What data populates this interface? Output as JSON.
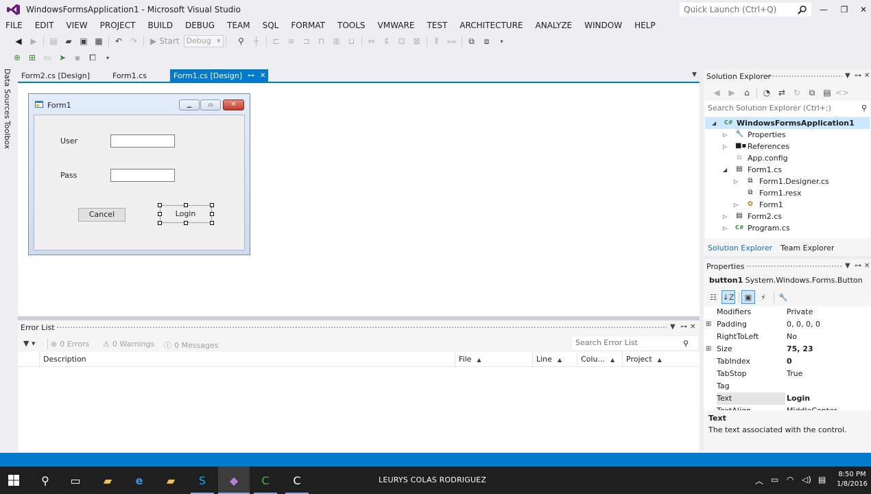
{
  "window": {
    "title": "WindowsFormsApplication1 - Microsoft Visual Studio",
    "quick_launch_placeholder": "Quick Launch (Ctrl+Q)"
  },
  "menu": [
    "FILE",
    "EDIT",
    "VIEW",
    "PROJECT",
    "BUILD",
    "DEBUG",
    "TEAM",
    "SQL",
    "FORMAT",
    "TOOLS",
    "VMWARE",
    "TEST",
    "ARCHITECTURE",
    "ANALYZE",
    "WINDOW",
    "HELP"
  ],
  "toolbar": {
    "start_label": "Start",
    "config_value": "Debug"
  },
  "side_tabs": {
    "data_sources": "Data Sources",
    "toolbox": "Toolbox"
  },
  "doc_tabs": [
    {
      "label": "Form2.cs [Design]",
      "active": false
    },
    {
      "label": "Form1.cs",
      "active": false
    },
    {
      "label": "Form1.cs [Design]",
      "active": true
    }
  ],
  "form1": {
    "title": "Form1",
    "user_label": "User",
    "pass_label": "Pass",
    "cancel_button": "Cancel",
    "login_button": "Login"
  },
  "error_list": {
    "title": "Error List",
    "errors": "0 Errors",
    "warnings": "0 Warnings",
    "messages": "0 Messages",
    "search_placeholder": "Search Error List",
    "columns": [
      "Description",
      "File",
      "Line",
      "Colu...",
      "Project"
    ]
  },
  "solution_explorer": {
    "title": "Solution Explorer",
    "search_placeholder": "Search Solution Explorer (Ctrl+;)",
    "items": [
      {
        "label": "WindowsFormsApplication1",
        "icon": "csharp-project-icon",
        "expander": "expanded",
        "selected": true
      },
      {
        "label": "Properties",
        "icon": "wrench-icon",
        "expander": "collapsed"
      },
      {
        "label": "References",
        "icon": "references-icon",
        "expander": "collapsed"
      },
      {
        "label": "App.config",
        "icon": "config-file-icon",
        "expander": "none"
      },
      {
        "label": "Form1.cs",
        "icon": "form-file-icon",
        "expander": "expanded"
      },
      {
        "label": "Form1.Designer.cs",
        "icon": "designer-file-icon",
        "expander": "collapsed"
      },
      {
        "label": "Form1.resx",
        "icon": "resx-file-icon",
        "expander": "none"
      },
      {
        "label": "Form1",
        "icon": "class-icon",
        "expander": "collapsed"
      },
      {
        "label": "Form2.cs",
        "icon": "form-file-icon",
        "expander": "collapsed"
      },
      {
        "label": "Program.cs",
        "icon": "csharp-file-icon",
        "expander": "collapsed"
      }
    ],
    "tabs": [
      "Solution Explorer",
      "Team Explorer"
    ]
  },
  "properties": {
    "title": "Properties",
    "object_name": "button1",
    "object_type": "System.Windows.Forms.Button",
    "rows": [
      {
        "name": "Modifiers",
        "value": "Private",
        "expandable": false,
        "bold": false
      },
      {
        "name": "Padding",
        "value": "0, 0, 0, 0",
        "expandable": true,
        "bold": false
      },
      {
        "name": "RightToLeft",
        "value": "No",
        "expandable": false,
        "bold": false
      },
      {
        "name": "Size",
        "value": "75, 23",
        "expandable": true,
        "bold": true
      },
      {
        "name": "TabIndex",
        "value": "0",
        "expandable": false,
        "bold": true
      },
      {
        "name": "TabStop",
        "value": "True",
        "expandable": false,
        "bold": false
      },
      {
        "name": "Tag",
        "value": "",
        "expandable": false,
        "bold": false
      },
      {
        "name": "Text",
        "value": "Login",
        "expandable": false,
        "bold": true
      },
      {
        "name": "TextAlign",
        "value": "MiddleCenter",
        "expandable": false,
        "bold": false
      }
    ],
    "desc_title": "Text",
    "desc_text": "The text associated with the control."
  },
  "taskbar": {
    "user": "LEURYS COLAS RODRIGUEZ",
    "time": "8:50 PM",
    "date": "1/8/2016"
  },
  "colors": {
    "accent": "#007acc",
    "selection": "#cce8ff"
  }
}
